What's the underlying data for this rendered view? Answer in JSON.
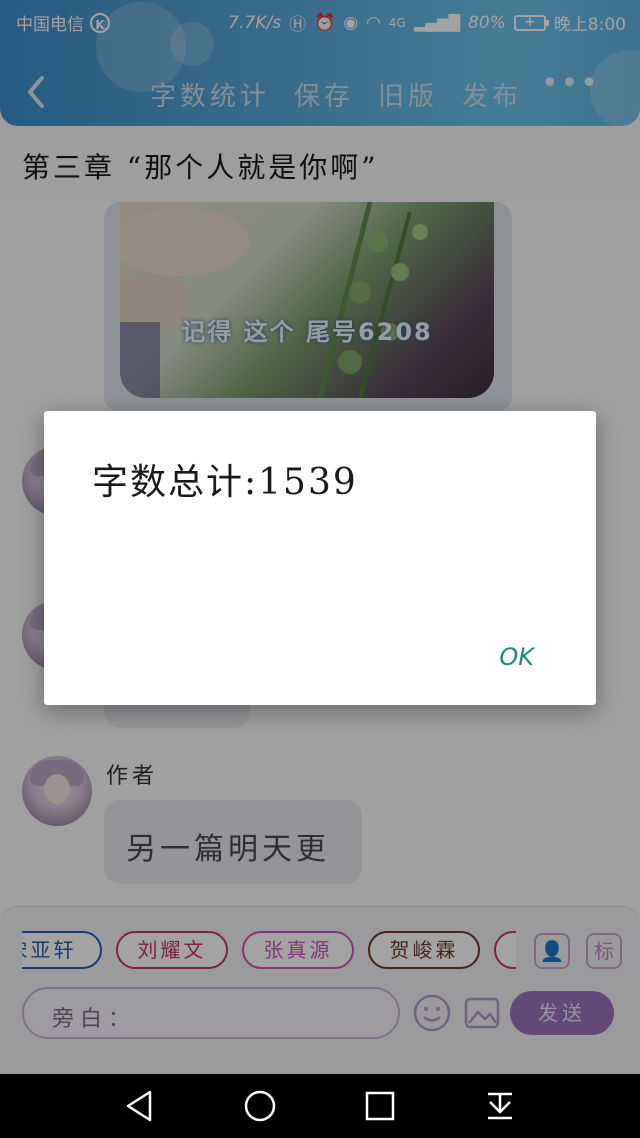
{
  "status_bar": {
    "carrier": "中国电信",
    "carrier_badge": "K",
    "speed": "7.7K/s",
    "network": "4G",
    "battery": "80%",
    "time": "晚上8:00"
  },
  "toolbar": {
    "items": [
      "字数统计",
      "保存",
      "旧版",
      "发布"
    ],
    "more": "•••"
  },
  "chapter": {
    "title": "第三章 “那个人就是你啊”"
  },
  "chat": {
    "image_caption": "记得 这个 尾号6208",
    "author_label": "作者",
    "last_message": "另一篇明天更"
  },
  "dialog": {
    "message": "字数总计:1539",
    "ok_label": "OK"
  },
  "input_bar": {
    "chips": [
      {
        "label": "宋亚轩",
        "color": "#2a5cae"
      },
      {
        "label": "刘耀文",
        "color": "#c0346a"
      },
      {
        "label": "张真源",
        "color": "#c957b6"
      },
      {
        "label": "贺峻霖",
        "color": "#6b3b2b"
      }
    ],
    "mark_label": "标",
    "narration_label": "旁白：",
    "send_label": "发送"
  },
  "colors": {
    "header_start": "#3d8fc8",
    "header_end": "#6cc2ea",
    "send_button": "#9a72bd",
    "ok_text": "#1c8a7e"
  }
}
